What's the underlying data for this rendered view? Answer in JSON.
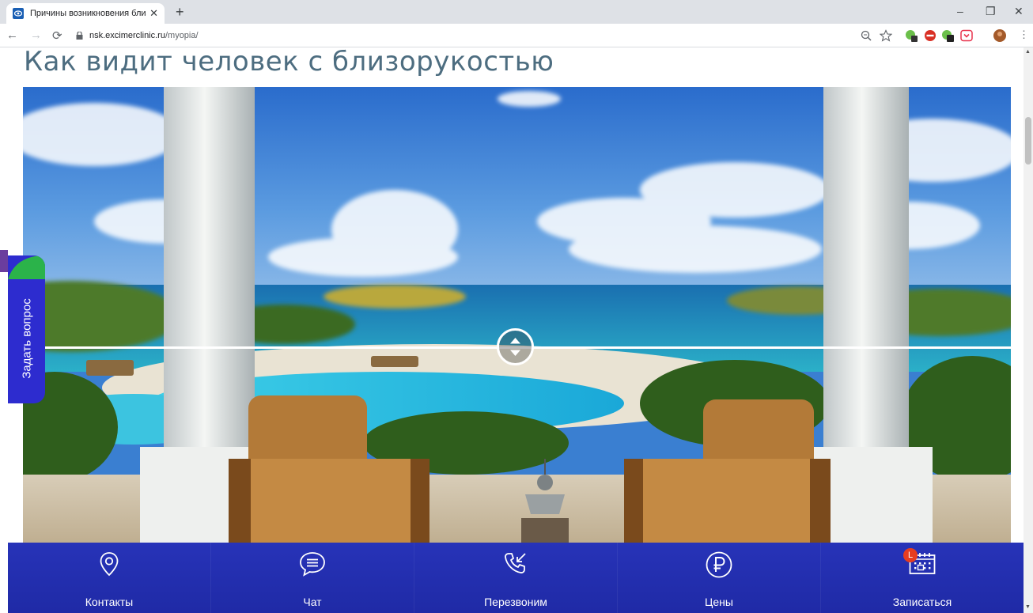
{
  "browser": {
    "tab_title": "Причины возникновения близо",
    "tab_close": "✕",
    "new_tab": "+",
    "url_host": "nsk.excimerclinic.ru",
    "url_path": "/myopia/",
    "window_controls": [
      "–",
      "❐",
      "✕"
    ]
  },
  "page": {
    "title": "Как видит человек с близорукостью"
  },
  "side_tab": {
    "label": "Задать вопрос"
  },
  "bottom_nav": {
    "items": [
      {
        "label": "Контакты",
        "icon": "location-pin-icon"
      },
      {
        "label": "Чат",
        "icon": "chat-bubble-icon"
      },
      {
        "label": "Перезвоним",
        "icon": "callback-phone-icon"
      },
      {
        "label": "Цены",
        "icon": "ruble-icon"
      },
      {
        "label": "Записаться",
        "icon": "calendar-icon"
      }
    ]
  },
  "colors": {
    "title": "#4d6d80",
    "nav_background": "#2733b8",
    "side_tab": "#2d2ccf",
    "badge": "#e63d1f"
  }
}
